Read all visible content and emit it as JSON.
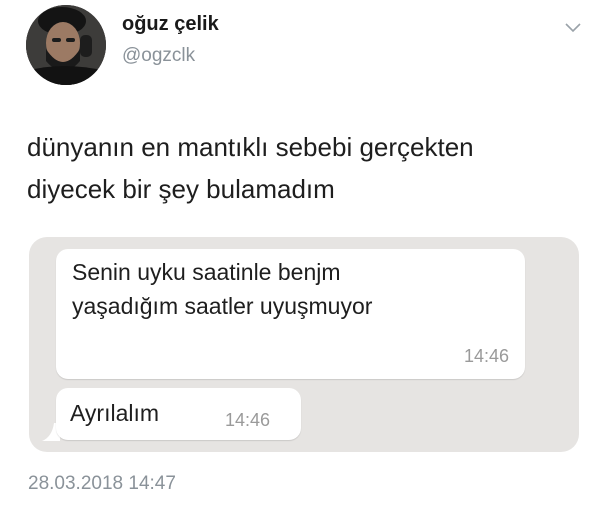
{
  "user": {
    "display_name": "oğuz çelik",
    "handle": "@ogzclk"
  },
  "icons": {
    "avatar": "profile-photo",
    "menu": "chevron-down-icon"
  },
  "tweet": {
    "text_lines": [
      "dünyanın en mantıklı sebebi gerçekten",
      "diyecek bir şey bulamadım"
    ],
    "timestamp": "28.03.2018 14:47"
  },
  "chat": {
    "messages": [
      {
        "lines": [
          "Senin uyku saatinle benjm",
          "yaşadığım saatler uyuşmuyor"
        ],
        "time": "14:46"
      },
      {
        "text": "Ayrılalım",
        "time": "14:46"
      }
    ]
  },
  "colors": {
    "text": "#1e1e1e",
    "muted": "#8a9299",
    "chat_background": "#e6e4e2",
    "bubble": "#ffffff"
  }
}
